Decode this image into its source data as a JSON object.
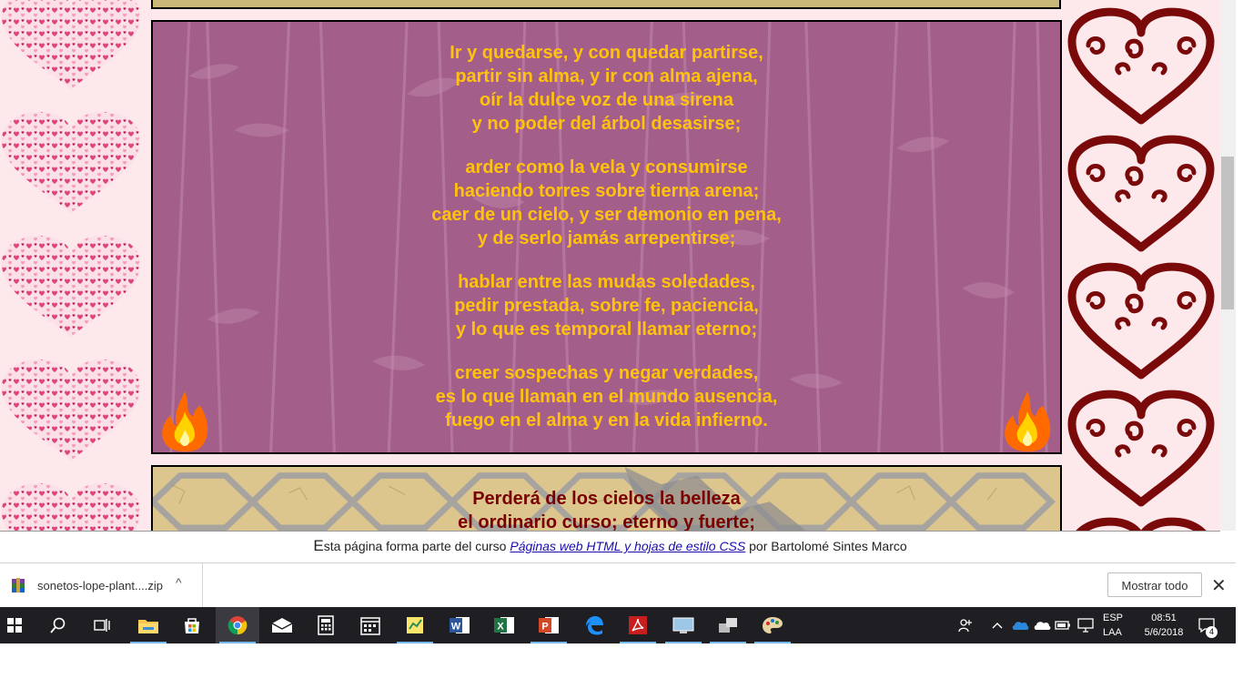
{
  "page": {
    "poem1": {
      "stanzas": [
        [
          "Ir y quedarse, y con quedar partirse,",
          "partir sin alma, y ir con alma ajena,",
          "oír la dulce voz de una sirena",
          "y no poder del árbol desasirse;"
        ],
        [
          "arder como la vela y consumirse",
          "haciendo torres sobre tierna arena;",
          "caer de un cielo, y ser demonio en pena,",
          "y de serlo jamás arrepentirse;"
        ],
        [
          "hablar entre las mudas soledades,",
          "pedir prestada, sobre fe, paciencia,",
          "y lo que es temporal llamar eterno;"
        ],
        [
          "creer sospechas y negar verdades,",
          "es lo que llaman en el mundo ausencia,",
          "fuego en el alma y en la vida infierno."
        ]
      ],
      "text_color": "#ffc20e"
    },
    "poem2": {
      "lines": [
        "Perderá de los cielos la belleza",
        "el ordinario curso; eterno y fuerte;"
      ],
      "text_color": "#7a0000"
    },
    "footer": {
      "first_letter": "E",
      "prefix": "sta página forma parte del curso ",
      "link": "Páginas web HTML y hojas de estilo CSS",
      "suffix": " por Bartolomé Sintes Marco"
    }
  },
  "download_bar": {
    "filename": "sonetos-lope-plant....zip",
    "caret": "^",
    "show_all": "Mostrar todo",
    "close": "✕"
  },
  "taskbar": {
    "apps": [
      "start-icon",
      "search-icon",
      "task-view-icon",
      "file-explorer-icon",
      "store-icon",
      "chrome-icon",
      "mail-icon",
      "calculator-icon",
      "calendar-icon",
      "sticky-notes-icon",
      "word-icon",
      "excel-icon",
      "powerpoint-icon",
      "edge-icon",
      "acrobat-icon",
      "app-icon",
      "app-icon",
      "paint-icon"
    ],
    "language_top": "ESP",
    "language_bottom": "LAA",
    "time": "08:51",
    "date": "5/6/2018",
    "notifications": "4"
  },
  "colors": {
    "page_bg": "#fde8ec",
    "heart_right": "#7a0a0a",
    "hearts_left": "#e0457a",
    "taskbar": "#1f1f23",
    "accent": "#76b9ed"
  }
}
